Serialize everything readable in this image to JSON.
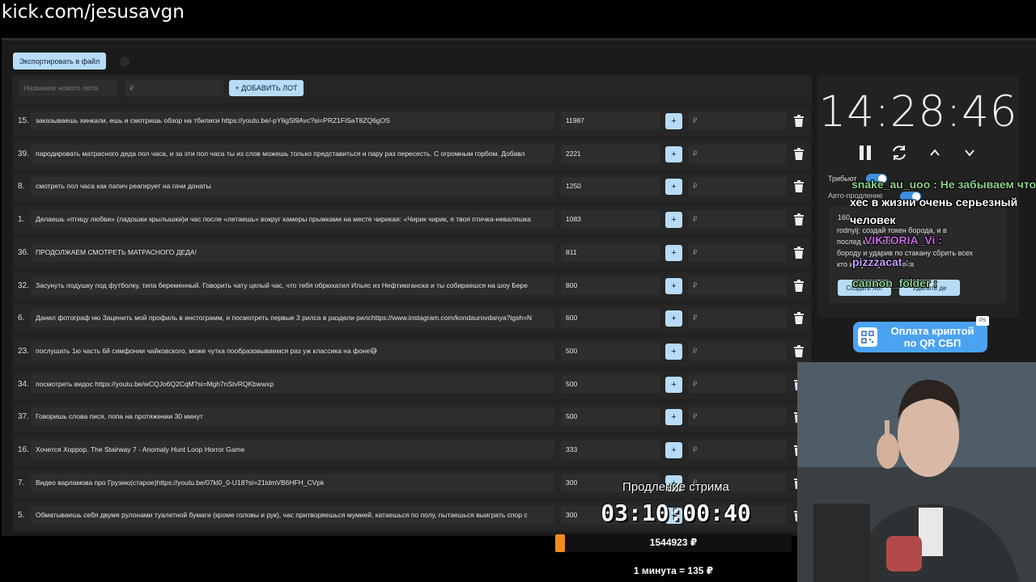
{
  "browser": {
    "url": "kick.com/jesusavgn"
  },
  "toolbar": {
    "export_label": "Экспортировать в файл"
  },
  "new_lot": {
    "name_placeholder": "Название нового лота",
    "price_placeholder": "₽",
    "add_label": "+ ДОБАВИТЬ ЛОТ"
  },
  "lots": [
    {
      "num": "15.",
      "text": "заказываешь хинкали, ешь и смотришь обзор на тбилиси https://youtu.be/-pY6gSl9Avc?si=PRZ1FiSaT8ZQ6gOS",
      "amount": "11987",
      "price_placeholder": "₽",
      "plus": "+"
    },
    {
      "num": "39.",
      "text": "пародировать матрасного деда пол часа, и за эти пол часа ты из слов можешь только представиться и пару раз пересесть. С огромным горбом. Добавл",
      "amount": "2221",
      "price_placeholder": "₽",
      "plus": "+"
    },
    {
      "num": "8.",
      "text": "смотреть пол часа как папич реагирует на гачи донаты",
      "amount": "1250",
      "price_placeholder": "₽",
      "plus": "+"
    },
    {
      "num": "1.",
      "text": "Делаешь «птицу любви» (ладошки крылышки)и час после «летаешь» вокруг камеры прыжками на месте чирикая: «Чирик чирик, я твоя птичка-неваляшка",
      "amount": "1083",
      "price_placeholder": "₽",
      "plus": "+"
    },
    {
      "num": "36.",
      "text": "ПРОДОЛЖАЕМ СМОТРЕТЬ МАТРАСНОГО ДЕДА!",
      "amount": "811",
      "price_placeholder": "₽",
      "plus": "+"
    },
    {
      "num": "32.",
      "text": "Засунуть подушку под футболку, типа беременный. Говорить чату целый час, что тебя обрюхатил Ильяс из Нефтиюганска и ты собираешся на шоу Бере",
      "amount": "800",
      "price_placeholder": "₽",
      "plus": "+"
    },
    {
      "num": "6.",
      "text": "Данил фотограф ню Заценить мой профиль в инстограмм, и посмотреть первые 3 рилса в раздели рилсhttps://www.instagram.com/kondaurovdanya?igsh=N",
      "amount": "600",
      "price_placeholder": "₽",
      "plus": "+"
    },
    {
      "num": "23.",
      "text": "послушать 1ю часть 6й симфонии чайковского, може чутка пообразовываемся раз уж классика на фоне😅",
      "amount": "500",
      "price_placeholder": "₽",
      "plus": "+"
    },
    {
      "num": "34.",
      "text": "посмотреть видос https://youtu.be/wCQJo6Q2CqM?si=Mgh7nStvRQKbwwxp",
      "amount": "500",
      "price_placeholder": "₽",
      "plus": "+"
    },
    {
      "num": "37.",
      "text": "Говоришь слова пися, попа на протяжении 30 минут",
      "amount": "500",
      "price_placeholder": "₽",
      "plus": "+"
    },
    {
      "num": "16.",
      "text": "Хочется Хоррор. The Stairway 7 - Anomaly Hunt Loop Horror Game",
      "amount": "333",
      "price_placeholder": "₽",
      "plus": "+"
    },
    {
      "num": "7.",
      "text": "Видео варламова про Грузию(старое)https://youtu.be/07kl0_0-U18?si=21ldmVB6HFH_CVpk",
      "amount": "300",
      "price_placeholder": "₽",
      "plus": "+"
    },
    {
      "num": "5.",
      "text": "Обматываешь себя двумя рулонами туалетной бумаги (кроме головы и рук), час притворяешься мумией, катаешься по полу, пытаешься выиграть спор с",
      "amount": "300",
      "price_placeholder": "₽",
      "plus": "+"
    }
  ],
  "timer": {
    "time": "14:28:46",
    "tribute_label": "Трибьют",
    "auto_label": "Авто-продление",
    "token_count": "160",
    "token_text_1": "rodnyij: создай токен борода, и в",
    "token_text_2": "послед            ешь себе сбрей",
    "token_text_3": "бороду и ударив по стакану сбрить всех",
    "token_text_4": "кто              ирку хехус ихихяхя",
    "create_label": "Создать лот",
    "delete_label": "Удалить де"
  },
  "chat": [
    {
      "text": "snake_au_uoo : Не забываем  что",
      "color": "#8cd08c"
    },
    {
      "text": "хес в жизни очень серьезный",
      "color": "#ffffff"
    },
    {
      "text": "человек",
      "color": "#ffffff"
    },
    {
      "text": "VIKTORIA_Vi :",
      "color": "#c46bdf"
    },
    {
      "text": "pizzzacat :",
      "color": "#c8a0ff"
    },
    {
      "text": "cannon_folder :",
      "color": "#8cd08c"
    }
  ],
  "payment": {
    "line1": "Оплата криптой",
    "line2": "по QR СБП",
    "badge": "PS"
  },
  "extension": {
    "title": "Продление стрима",
    "clock": "03:10:00:40",
    "total": "1544923 ₽",
    "rate": "1 минута = 135 ₽",
    "progress_fraction": 0.04
  },
  "colors": {
    "accent": "#b8dcf7",
    "switch": "#3b8fe0",
    "progress": "#f08a1c"
  }
}
